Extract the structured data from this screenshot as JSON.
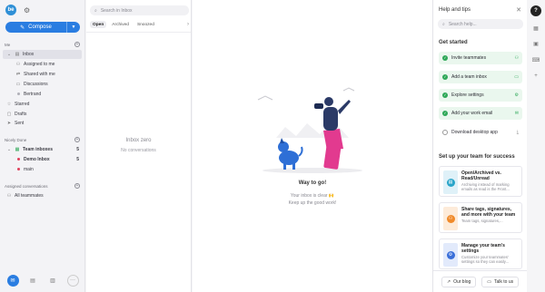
{
  "nav": {
    "avatar_initials": "be",
    "compose_label": "Compose",
    "me_section": "Me",
    "items": [
      {
        "label": "Inbox"
      },
      {
        "label": "Assigned to me"
      },
      {
        "label": "Shared with me"
      },
      {
        "label": "Discussions"
      },
      {
        "label": "Bertrand"
      },
      {
        "label": "Starred"
      },
      {
        "label": "Drafts"
      },
      {
        "label": "Sent"
      }
    ],
    "team_section": "Nicely Done",
    "team_inboxes": {
      "label": "Team inboxes",
      "count": "5"
    },
    "demo_inbox": {
      "label": "Demo Inbox",
      "count": "5"
    },
    "main_inbox": {
      "label": "main"
    },
    "assigned_section": "Assigned conversations",
    "all_teammates": "All teammates"
  },
  "list": {
    "search_placeholder": "Search in Inbox",
    "tabs": [
      "Open",
      "Archived",
      "Snoozed"
    ],
    "zero_title": "Inbox zero",
    "zero_sub": "No conversations"
  },
  "main": {
    "title": "Way to go!",
    "line1": "Your inbox is clear 🙌",
    "line2": "Keep up the good work!"
  },
  "help": {
    "title": "Help and tips",
    "search_placeholder": "Search help...",
    "get_started": "Get started",
    "steps": [
      {
        "label": "Invite teammates",
        "done": true,
        "icon": "user-plus-icon"
      },
      {
        "label": "Add a team inbox",
        "done": true,
        "icon": "inbox-icon"
      },
      {
        "label": "Explore settings",
        "done": true,
        "icon": "gear-icon"
      },
      {
        "label": "Add your work email",
        "done": true,
        "icon": "mail-icon"
      },
      {
        "label": "Download desktop app",
        "done": false,
        "icon": "download-icon"
      }
    ],
    "success_title": "Set up your team for success",
    "cards": [
      {
        "title": "Open/Archived vs. Read/Unread",
        "desc": "Archiving instead of marking emails as read is the Front...",
        "color": "#2aa5c9",
        "bg": "#dff1f8"
      },
      {
        "title": "Share tags, signatures, and more with your team",
        "desc": "Team tags, signatures,...",
        "color": "#f08a2a",
        "bg": "#fdebd9"
      },
      {
        "title": "Manage your team's settings",
        "desc": "Customize your teammates' settings so they can easily...",
        "color": "#3a6fd9",
        "bg": "#e2eafb"
      }
    ],
    "blog_label": "Our blog",
    "talk_label": "Talk to us"
  },
  "colors": {
    "accent": "#2a7de1",
    "success": "#2ea858",
    "unread": "#e0415c"
  }
}
